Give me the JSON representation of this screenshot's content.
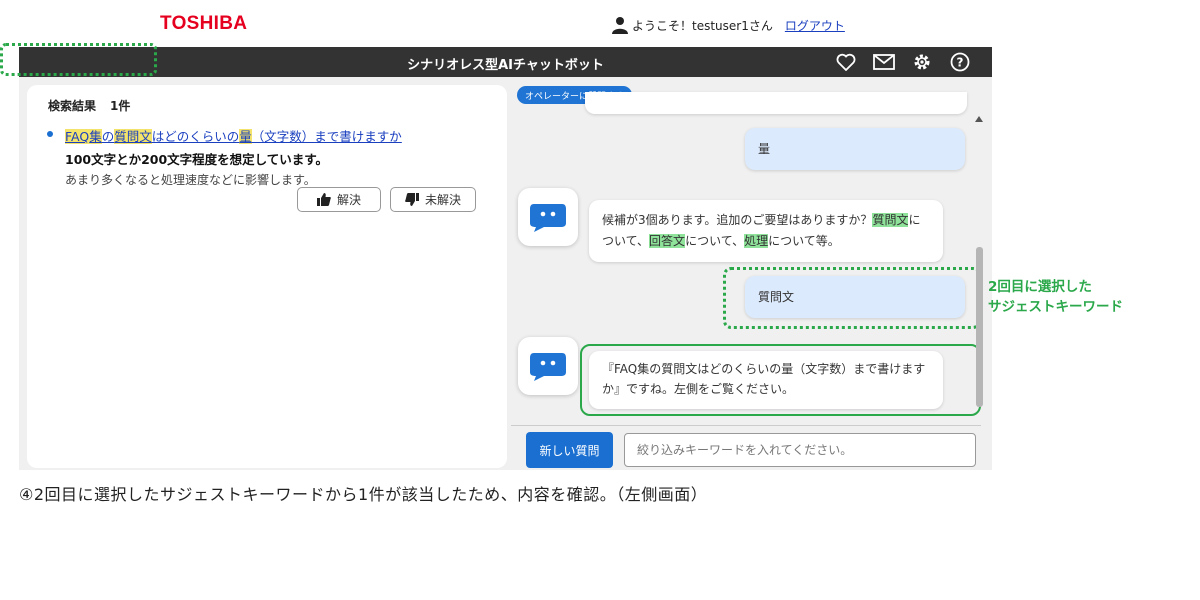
{
  "header": {
    "logo": "TOSHIBA",
    "greeting": "ようこそ！testuser1さん",
    "logout": "ログアウト"
  },
  "app": {
    "title": "シナリオレス型AIチャットボット",
    "icons": [
      "heart-icon",
      "mail-icon",
      "gear-icon",
      "help-icon"
    ]
  },
  "left": {
    "result_label": "検索結果",
    "result_count": "1件",
    "item": {
      "title_parts": [
        "FAQ",
        "集",
        "の",
        "質問文",
        "はどのくらいの",
        "量",
        "（文字数）まで書けますか"
      ],
      "answer_bold": "100文字とか200文字程度を想定しています。",
      "answer_text": "あまり多くなると処理速度などに影響します。"
    },
    "resolved_label": "解決",
    "unresolved_label": "未解決"
  },
  "chat": {
    "operator_button": "オペレーターに質問する",
    "messages": [
      {
        "from": "user",
        "text": "量"
      },
      {
        "from": "bot",
        "parts": [
          "候補が3個あります。追加のご要望はありますか？",
          "質問文",
          "に",
          "ついて、",
          "回答文",
          "について、",
          "処理",
          "について等。"
        ]
      },
      {
        "from": "user",
        "text": "質問文"
      },
      {
        "from": "bot",
        "text1": "『FAQ集の質問文はどのくらいの量（文字数）まで書けます",
        "text2": "か』ですね。左側をご覧ください。"
      }
    ],
    "new_question": "新しい質問",
    "input_placeholder": "絞り込みキーワードを入れてください。"
  },
  "annotation": {
    "line1": "2回目に選択した",
    "line2": "サジェストキーワード"
  },
  "caption": "④2回目に選択したサジェストキーワードから1件が該当したため、内容を確認。（左側画面）",
  "colors": {
    "brand_red": "#e6001f",
    "titlebar": "#333333",
    "accent_blue": "#1a6fd1",
    "annotation_green": "#2aa84a",
    "keyword_highlight": "#8fe29a",
    "search_highlight": "#f3e36b"
  }
}
